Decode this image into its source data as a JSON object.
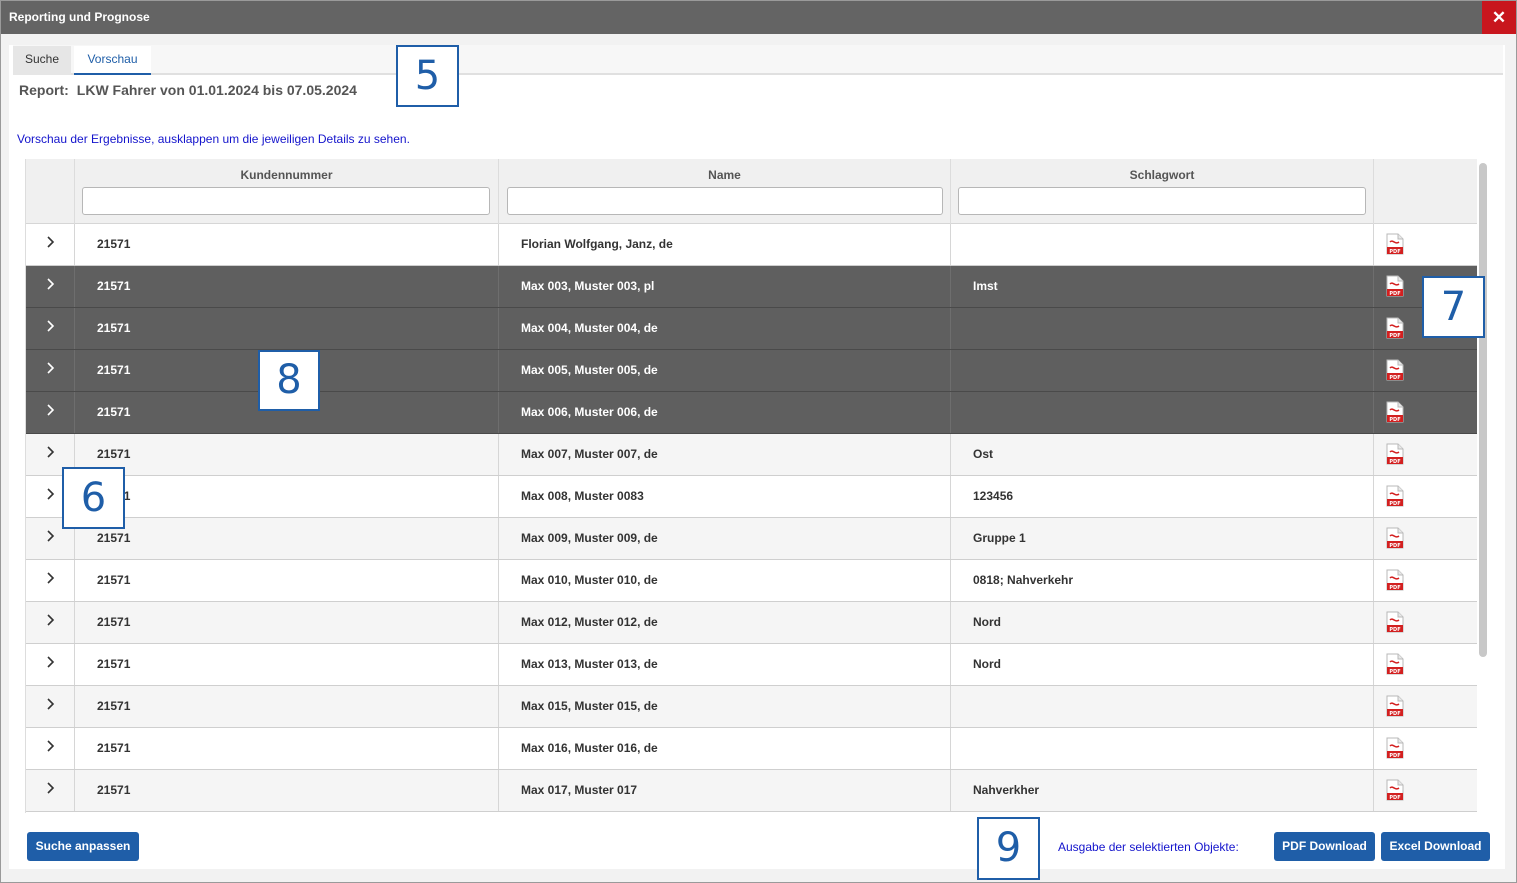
{
  "window": {
    "title": "Reporting und Prognose",
    "close_label": "✕"
  },
  "tabs": [
    {
      "label": "Suche"
    },
    {
      "label": "Vorschau"
    }
  ],
  "report": {
    "label": "Report:",
    "title": "LKW Fahrer von 01.01.2024 bis 07.05.2024"
  },
  "hint": "Vorschau der Ergebnisse, ausklappen um die jeweiligen Details zu sehen.",
  "table": {
    "headers": {
      "kundennummer": "Kundennummer",
      "name": "Name",
      "schlagwort": "Schlagwort"
    },
    "rows": [
      {
        "kd": "21571",
        "name": "Florian Wolfgang, Janz, de",
        "sw": "",
        "selected": false
      },
      {
        "kd": "21571",
        "name": "Max 003, Muster 003, pl",
        "sw": "Imst",
        "selected": true
      },
      {
        "kd": "21571",
        "name": "Max 004, Muster 004, de",
        "sw": "",
        "selected": true
      },
      {
        "kd": "21571",
        "name": "Max 005, Muster 005, de",
        "sw": "",
        "selected": true
      },
      {
        "kd": "21571",
        "name": "Max 006, Muster 006, de",
        "sw": "",
        "selected": true
      },
      {
        "kd": "21571",
        "name": "Max 007, Muster 007, de",
        "sw": "Ost",
        "selected": false
      },
      {
        "kd": "21571",
        "name": "Max 008, Muster 0083",
        "sw": "123456",
        "selected": false
      },
      {
        "kd": "21571",
        "name": "Max 009, Muster 009, de",
        "sw": "Gruppe 1",
        "selected": false
      },
      {
        "kd": "21571",
        "name": "Max 010, Muster 010, de",
        "sw": "0818; Nahverkehr",
        "selected": false
      },
      {
        "kd": "21571",
        "name": "Max 012, Muster 012, de",
        "sw": "Nord",
        "selected": false
      },
      {
        "kd": "21571",
        "name": "Max 013, Muster 013, de",
        "sw": "Nord",
        "selected": false
      },
      {
        "kd": "21571",
        "name": "Max 015, Muster 015, de",
        "sw": "",
        "selected": false
      },
      {
        "kd": "21571",
        "name": "Max 016, Muster 016, de",
        "sw": "",
        "selected": false
      },
      {
        "kd": "21571",
        "name": "Max 017, Muster 017",
        "sw": "Nahverkher",
        "selected": false
      }
    ]
  },
  "icons": {
    "expand": "chevron-right-icon",
    "pdf": "pdf-file-icon",
    "pdf_text": "PDF"
  },
  "footer": {
    "adjust_label": "Suche anpassen",
    "output_label": "Ausgabe der selektierten Objekte:",
    "pdf_label": "PDF Download",
    "excel_label": "Excel Download"
  },
  "badges": {
    "b5": "5",
    "b6": "6",
    "b7": "7",
    "b8": "8",
    "b9": "9"
  },
  "colors": {
    "accent": "#1f5ea8",
    "close": "#c8161d",
    "selected_row": "#5f5f5f",
    "titlebar": "#646464"
  }
}
